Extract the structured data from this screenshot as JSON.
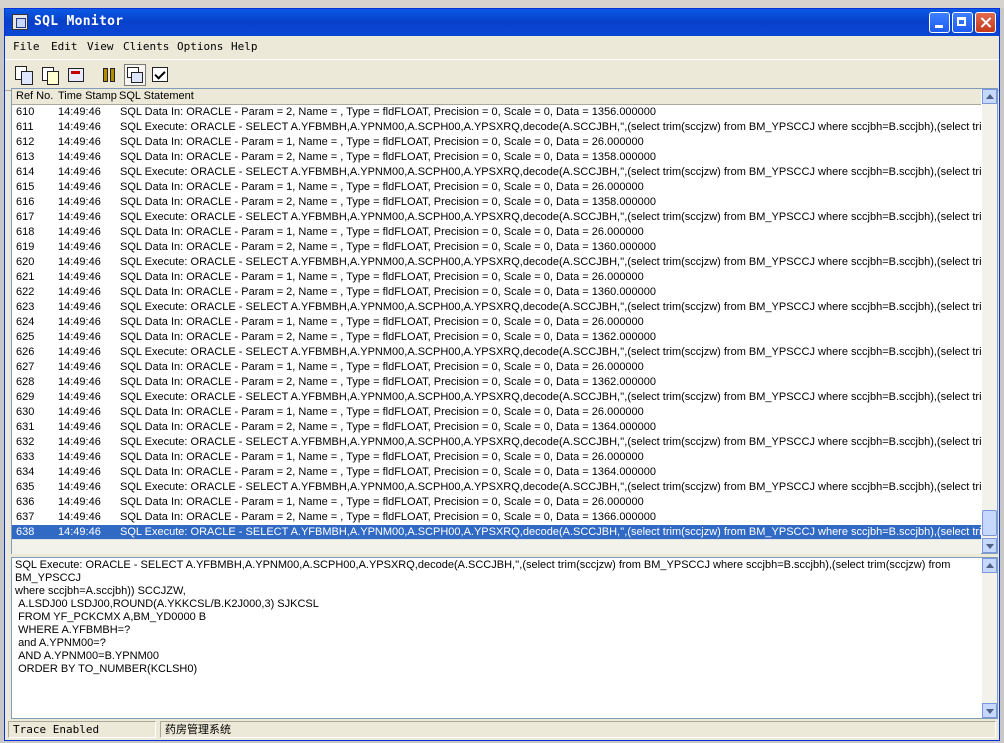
{
  "window": {
    "title": "SQL Monitor"
  },
  "menu": [
    "File",
    "Edit",
    "View",
    "Clients",
    "Options",
    "Help"
  ],
  "toolbar_icons": [
    "log-copy-icon",
    "copy-icon",
    "clear-log-icon",
    "pause-icon",
    "auto-scroll-icon",
    "trace-options-icon"
  ],
  "list": {
    "headers": {
      "ref": "Ref No.",
      "time": "Time Stamp",
      "stmt": "SQL Statement"
    },
    "rows": [
      {
        "ref": "610",
        "time": "14:49:46",
        "stmt": "SQL Data In: ORACLE - Param = 2, Name = , Type = fldFLOAT, Precision = 0, Scale = 0, Data = 1356.000000"
      },
      {
        "ref": "611",
        "time": "14:49:46",
        "stmt": "SQL Execute: ORACLE - SELECT A.YFBMBH,A.YPNM00,A.SCPH00,A.YPSXRQ,decode(A.SCCJBH,'',(select trim(sccjzw) from BM_YPSCCJ where sccjbh=B.sccjbh),(select trim(sccjzw) from"
      },
      {
        "ref": "612",
        "time": "14:49:46",
        "stmt": "SQL Data In: ORACLE - Param = 1, Name = , Type = fldFLOAT, Precision = 0, Scale = 0, Data = 26.000000"
      },
      {
        "ref": "613",
        "time": "14:49:46",
        "stmt": "SQL Data In: ORACLE - Param = 2, Name = , Type = fldFLOAT, Precision = 0, Scale = 0, Data = 1358.000000"
      },
      {
        "ref": "614",
        "time": "14:49:46",
        "stmt": "SQL Execute: ORACLE - SELECT A.YFBMBH,A.YPNM00,A.SCPH00,A.YPSXRQ,decode(A.SCCJBH,'',(select trim(sccjzw) from BM_YPSCCJ where sccjbh=B.sccjbh),(select trim(sccjzw) from"
      },
      {
        "ref": "615",
        "time": "14:49:46",
        "stmt": "SQL Data In: ORACLE - Param = 1, Name = , Type = fldFLOAT, Precision = 0, Scale = 0, Data = 26.000000"
      },
      {
        "ref": "616",
        "time": "14:49:46",
        "stmt": "SQL Data In: ORACLE - Param = 2, Name = , Type = fldFLOAT, Precision = 0, Scale = 0, Data = 1358.000000"
      },
      {
        "ref": "617",
        "time": "14:49:46",
        "stmt": "SQL Execute: ORACLE - SELECT A.YFBMBH,A.YPNM00,A.SCPH00,A.YPSXRQ,decode(A.SCCJBH,'',(select trim(sccjzw) from BM_YPSCCJ where sccjbh=B.sccjbh),(select trim(sccjzw) from"
      },
      {
        "ref": "618",
        "time": "14:49:46",
        "stmt": "SQL Data In: ORACLE - Param = 1, Name = , Type = fldFLOAT, Precision = 0, Scale = 0, Data = 26.000000"
      },
      {
        "ref": "619",
        "time": "14:49:46",
        "stmt": "SQL Data In: ORACLE - Param = 2, Name = , Type = fldFLOAT, Precision = 0, Scale = 0, Data = 1360.000000"
      },
      {
        "ref": "620",
        "time": "14:49:46",
        "stmt": "SQL Execute: ORACLE - SELECT A.YFBMBH,A.YPNM00,A.SCPH00,A.YPSXRQ,decode(A.SCCJBH,'',(select trim(sccjzw) from BM_YPSCCJ where sccjbh=B.sccjbh),(select trim(sccjzw) from"
      },
      {
        "ref": "621",
        "time": "14:49:46",
        "stmt": "SQL Data In: ORACLE - Param = 1, Name = , Type = fldFLOAT, Precision = 0, Scale = 0, Data = 26.000000"
      },
      {
        "ref": "622",
        "time": "14:49:46",
        "stmt": "SQL Data In: ORACLE - Param = 2, Name = , Type = fldFLOAT, Precision = 0, Scale = 0, Data = 1360.000000"
      },
      {
        "ref": "623",
        "time": "14:49:46",
        "stmt": "SQL Execute: ORACLE - SELECT A.YFBMBH,A.YPNM00,A.SCPH00,A.YPSXRQ,decode(A.SCCJBH,'',(select trim(sccjzw) from BM_YPSCCJ where sccjbh=B.sccjbh),(select trim(sccjzw) from"
      },
      {
        "ref": "624",
        "time": "14:49:46",
        "stmt": "SQL Data In: ORACLE - Param = 1, Name = , Type = fldFLOAT, Precision = 0, Scale = 0, Data = 26.000000"
      },
      {
        "ref": "625",
        "time": "14:49:46",
        "stmt": "SQL Data In: ORACLE - Param = 2, Name = , Type = fldFLOAT, Precision = 0, Scale = 0, Data = 1362.000000"
      },
      {
        "ref": "626",
        "time": "14:49:46",
        "stmt": "SQL Execute: ORACLE - SELECT A.YFBMBH,A.YPNM00,A.SCPH00,A.YPSXRQ,decode(A.SCCJBH,'',(select trim(sccjzw) from BM_YPSCCJ where sccjbh=B.sccjbh),(select trim(sccjzw) from"
      },
      {
        "ref": "627",
        "time": "14:49:46",
        "stmt": "SQL Data In: ORACLE - Param = 1, Name = , Type = fldFLOAT, Precision = 0, Scale = 0, Data = 26.000000"
      },
      {
        "ref": "628",
        "time": "14:49:46",
        "stmt": "SQL Data In: ORACLE - Param = 2, Name = , Type = fldFLOAT, Precision = 0, Scale = 0, Data = 1362.000000"
      },
      {
        "ref": "629",
        "time": "14:49:46",
        "stmt": "SQL Execute: ORACLE - SELECT A.YFBMBH,A.YPNM00,A.SCPH00,A.YPSXRQ,decode(A.SCCJBH,'',(select trim(sccjzw) from BM_YPSCCJ where sccjbh=B.sccjbh),(select trim(sccjzw) from"
      },
      {
        "ref": "630",
        "time": "14:49:46",
        "stmt": "SQL Data In: ORACLE - Param = 1, Name = , Type = fldFLOAT, Precision = 0, Scale = 0, Data = 26.000000"
      },
      {
        "ref": "631",
        "time": "14:49:46",
        "stmt": "SQL Data In: ORACLE - Param = 2, Name = , Type = fldFLOAT, Precision = 0, Scale = 0, Data = 1364.000000"
      },
      {
        "ref": "632",
        "time": "14:49:46",
        "stmt": "SQL Execute: ORACLE - SELECT A.YFBMBH,A.YPNM00,A.SCPH00,A.YPSXRQ,decode(A.SCCJBH,'',(select trim(sccjzw) from BM_YPSCCJ where sccjbh=B.sccjbh),(select trim(sccjzw) from"
      },
      {
        "ref": "633",
        "time": "14:49:46",
        "stmt": "SQL Data In: ORACLE - Param = 1, Name = , Type = fldFLOAT, Precision = 0, Scale = 0, Data = 26.000000"
      },
      {
        "ref": "634",
        "time": "14:49:46",
        "stmt": "SQL Data In: ORACLE - Param = 2, Name = , Type = fldFLOAT, Precision = 0, Scale = 0, Data = 1364.000000"
      },
      {
        "ref": "635",
        "time": "14:49:46",
        "stmt": "SQL Execute: ORACLE - SELECT A.YFBMBH,A.YPNM00,A.SCPH00,A.YPSXRQ,decode(A.SCCJBH,'',(select trim(sccjzw) from BM_YPSCCJ where sccjbh=B.sccjbh),(select trim(sccjzw) from"
      },
      {
        "ref": "636",
        "time": "14:49:46",
        "stmt": "SQL Data In: ORACLE - Param = 1, Name = , Type = fldFLOAT, Precision = 0, Scale = 0, Data = 26.000000"
      },
      {
        "ref": "637",
        "time": "14:49:46",
        "stmt": "SQL Data In: ORACLE - Param = 2, Name = , Type = fldFLOAT, Precision = 0, Scale = 0, Data = 1366.000000"
      },
      {
        "ref": "638",
        "time": "14:49:46",
        "stmt": "SQL Execute: ORACLE - SELECT A.YFBMBH,A.YPNM00,A.SCPH00,A.YPSXRQ,decode(A.SCCJBH,'',(select trim(sccjzw) from BM_YPSCCJ where sccjbh=B.sccjbh),(select trim(sccjzw) from",
        "selected": true
      }
    ]
  },
  "detail": {
    "text": "SQL Execute: ORACLE - SELECT A.YFBMBH,A.YPNM00,A.SCPH00,A.YPSXRQ,decode(A.SCCJBH,'',(select trim(sccjzw) from BM_YPSCCJ where sccjbh=B.sccjbh),(select trim(sccjzw) from BM_YPSCCJ\nwhere sccjbh=A.sccjbh)) SCCJZW,\n A.LSDJ00 LSDJ00,ROUND(A.YKKCSL/B.K2J000,3) SJKCSL\n FROM YF_PCKCMX A,BM_YD0000 B\n WHERE A.YFBMBH=?\n and A.YPNM00=?\n AND A.YPNM00=B.YPNM00\n ORDER BY TO_NUMBER(KCLSH0)"
  },
  "status": {
    "trace": "Trace Enabled",
    "client": "药房管理系统"
  }
}
